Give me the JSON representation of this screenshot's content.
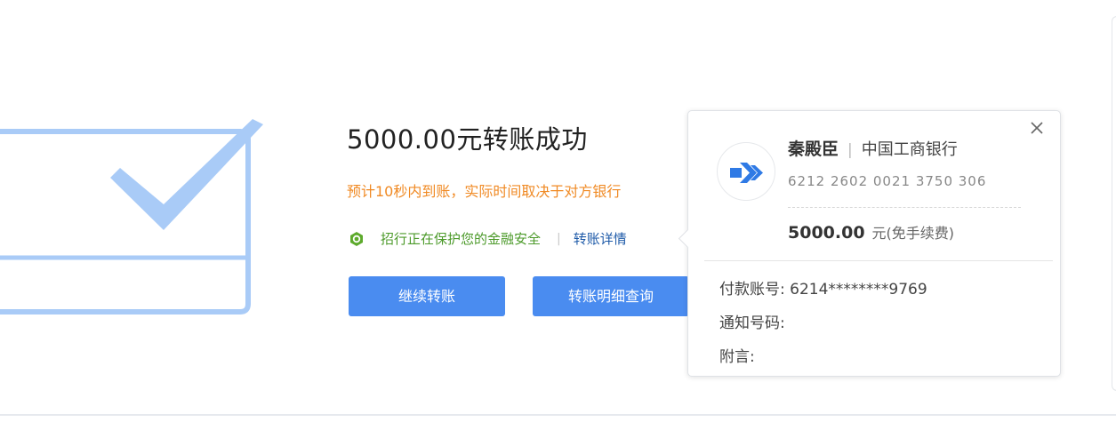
{
  "result": {
    "title": "5000.00元转账成功",
    "eta": "预计10秒内到账，实际时间取决于对方银行",
    "security_text": "招行正在保护您的金融安全",
    "separator": "|",
    "detail_link": "转账详情",
    "continue_button": "继续转账",
    "history_button": "转账明细查询"
  },
  "popover": {
    "recipient_name": "秦殿臣",
    "separator": "|",
    "bank_name": "中国工商银行",
    "card_number": "6212 2602 0021 3750 306",
    "amount": "5000.00",
    "amount_unit": "元(免手续费)",
    "payer_account": "付款账号: 6214********9769",
    "notify_number": "通知号码:",
    "memo": "附言:"
  },
  "icons": {
    "success": "check-box-icon",
    "security": "shield-icon",
    "transfer": "arrow-right-icon",
    "close": "close-icon"
  },
  "colors": {
    "accent_blue": "#4a8cf0",
    "success_light_blue": "#a9cbf7",
    "warning_orange": "#f08a24",
    "security_green": "#4c9a2a",
    "link_blue": "#1e5aa8"
  }
}
